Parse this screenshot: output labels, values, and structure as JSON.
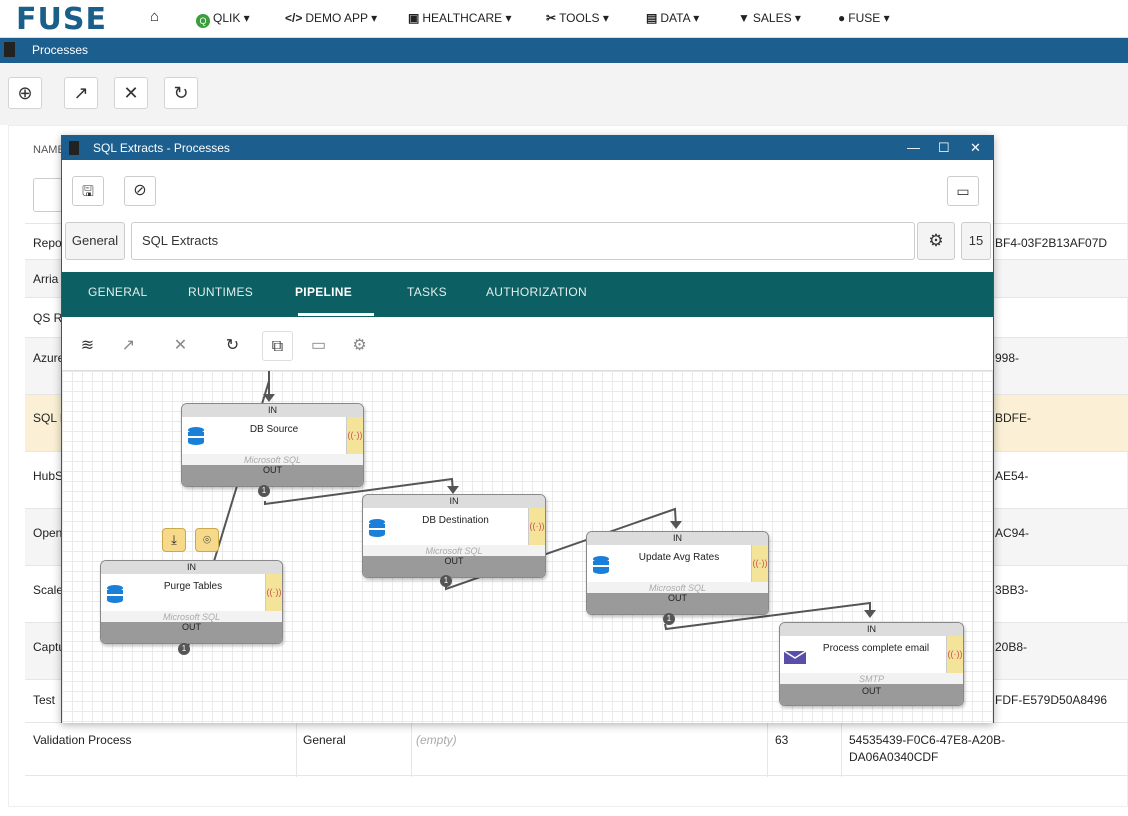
{
  "nav": {
    "logo": "FUSE",
    "items": [
      {
        "label": "QLIK ▾"
      },
      {
        "label": "DEMO APP ▾"
      },
      {
        "label": "HEALTHCARE ▾"
      },
      {
        "label": "TOOLS ▾"
      },
      {
        "label": "DATA ▾"
      },
      {
        "label": "SALES ▾"
      },
      {
        "label": "FUSE ▾"
      }
    ]
  },
  "page": {
    "title": "Processes"
  },
  "toolbar": {
    "add": "⊕",
    "open": "↗",
    "close": "✕",
    "refresh": "↻"
  },
  "table": {
    "header_name": "NAME",
    "rows": [
      {
        "name": "Repo",
        "id": "BF4-03F2B13AF07D"
      },
      {
        "name": "Arria",
        "id": ""
      },
      {
        "name": "QS R",
        "id": ""
      },
      {
        "name": "Azure",
        "id": "998-"
      },
      {
        "name": "SQL E",
        "id": "BDFE-"
      },
      {
        "name": "HubS",
        "id": "AE54-"
      },
      {
        "name": "Open",
        "id": "AC94-"
      },
      {
        "name": "Scale",
        "id": "3BB3-"
      },
      {
        "name": "Captu",
        "id": "20B8-"
      },
      {
        "name": "Test",
        "id": "FDF-E579D50A8496"
      }
    ],
    "last_row": {
      "name": "Validation Process",
      "type": "General",
      "desc": "(empty)",
      "num": "63",
      "id1": "54535439-F0C6-47E8-A20B-",
      "id2": "DA06A0340CDF"
    }
  },
  "modal": {
    "title": "SQL Extracts - Processes",
    "category": "General",
    "name_value": "SQL Extracts",
    "count": "15",
    "tabs": [
      "GENERAL",
      "RUNTIMES",
      "PIPELINE",
      "TASKS",
      "AUTHORIZATION"
    ],
    "active_tab": "PIPELINE"
  },
  "pipeline": {
    "port_in": "IN",
    "port_out": "OUT",
    "nodes": [
      {
        "label": "DB Source",
        "type": "Microsoft SQL",
        "badge": "1",
        "icon": "database-icon"
      },
      {
        "label": "DB Destination",
        "type": "Microsoft SQL",
        "badge": "1",
        "icon": "database-icon"
      },
      {
        "label": "Update Avg Rates",
        "type": "Microsoft SQL",
        "badge": "1",
        "icon": "database-icon"
      },
      {
        "label": "Purge Tables",
        "type": "Microsoft SQL",
        "badge": "1",
        "icon": "database-icon"
      },
      {
        "label": "Process complete email",
        "type": "SMTP",
        "icon": "email-icon"
      }
    ]
  },
  "colors": {
    "nav_blue": "#1c5f8e",
    "tab_teal": "#0c5f62",
    "node_side": "#f4e49a",
    "selected_row": "#fbf0d6"
  }
}
